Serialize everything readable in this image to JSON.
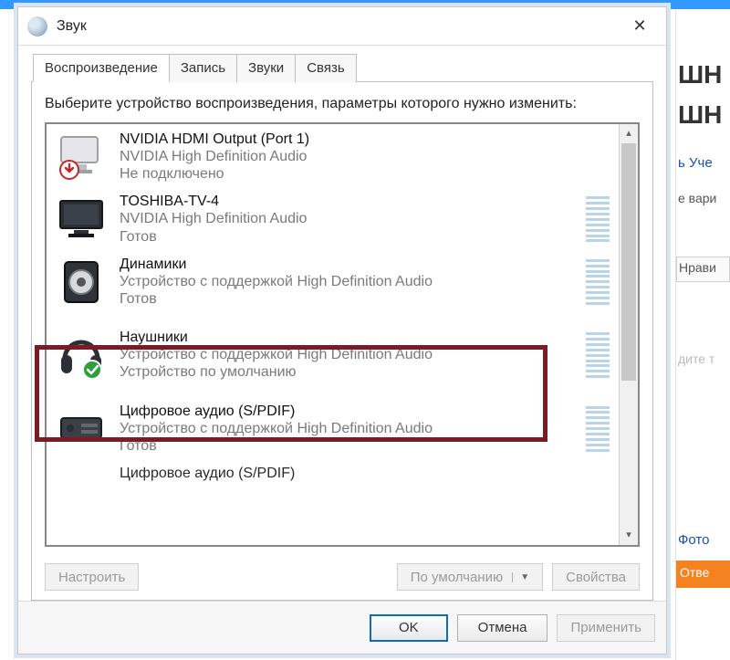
{
  "bg": {
    "h1a": "ШН",
    "h1b": "ШН",
    "login": "ь Уче",
    "variants": "е вари",
    "like": "Нрави",
    "enter": "дите т",
    "photo": "Фото",
    "answer": "Отве"
  },
  "dialog": {
    "title": "Звук",
    "close_icon": "✕",
    "tabs": {
      "playback": "Воспроизведение",
      "record": "Запись",
      "sounds": "Звуки",
      "comm": "Связь"
    },
    "instruction": "Выберите устройство воспроизведения, параметры которого нужно изменить:",
    "devices": [
      {
        "name": "NVIDIA HDMI Output (Port 1)",
        "sub": "NVIDIA High Definition Audio",
        "status": "Не подключено",
        "icon": "monitor-unplugged",
        "meter": false
      },
      {
        "name": "TOSHIBA-TV-4",
        "sub": "NVIDIA High Definition Audio",
        "status": "Готов",
        "icon": "tv",
        "meter": true
      },
      {
        "name": "Динамики",
        "sub": "Устройство с поддержкой High Definition Audio",
        "status": "Готов",
        "icon": "speaker",
        "meter": true
      },
      {
        "name": "Наушники",
        "sub": "Устройство с поддержкой High Definition Audio",
        "status": "Устройство по умолчанию",
        "icon": "headphones-default",
        "meter": true
      },
      {
        "name": "Цифровое аудио (S/PDIF)",
        "sub": "Устройство с поддержкой High Definition Audio",
        "status": "Готов",
        "icon": "receiver",
        "meter": true
      },
      {
        "name": "Цифровое аудио (S/PDIF)",
        "sub": "",
        "status": "",
        "icon": "receiver",
        "meter": false
      }
    ],
    "buttons": {
      "configure": "Настроить",
      "default": "По умолчанию",
      "properties": "Свойства",
      "ok": "OK",
      "cancel": "Отмена",
      "apply": "Применить"
    }
  }
}
